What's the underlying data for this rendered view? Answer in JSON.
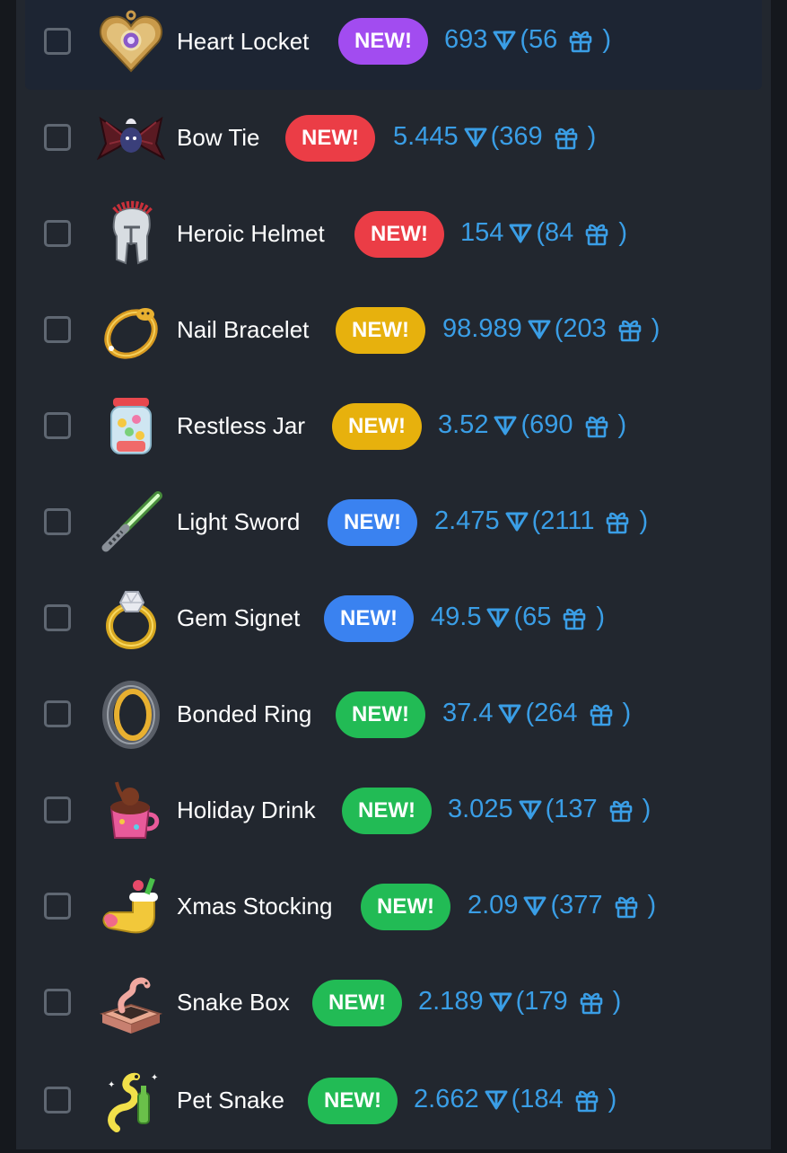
{
  "colors": {
    "background": "#15181d",
    "panel": "#22272f",
    "highlight_row": "#1d2533",
    "name_text": "#ffffff",
    "price_text": "#3a9ee6",
    "checkbox_border": "#5f6772"
  },
  "items": [
    {
      "name": "Heart Locket",
      "badge": "NEW!",
      "badge_color": "#a24cf0",
      "price": "693",
      "supply": "(56",
      "close": ")",
      "selected": false,
      "highlighted": true
    },
    {
      "name": "Bow Tie",
      "badge": "NEW!",
      "badge_color": "#eb3d46",
      "price": "5.445",
      "supply": "(369",
      "close": ")",
      "selected": false,
      "highlighted": false
    },
    {
      "name": "Heroic Helmet",
      "badge": "NEW!",
      "badge_color": "#eb3d46",
      "price": "154",
      "supply": "(84",
      "close": ")",
      "selected": false,
      "highlighted": false
    },
    {
      "name": "Nail Bracelet",
      "badge": "NEW!",
      "badge_color": "#e7b10d",
      "price": "98.989",
      "supply": "(203",
      "close": ")",
      "selected": false,
      "highlighted": false
    },
    {
      "name": "Restless Jar",
      "badge": "NEW!",
      "badge_color": "#e7b10d",
      "price": "3.52",
      "supply": "(690",
      "close": ")",
      "selected": false,
      "highlighted": false
    },
    {
      "name": "Light Sword",
      "badge": "NEW!",
      "badge_color": "#3a82f0",
      "price": "2.475",
      "supply": "(2111",
      "close": ")",
      "selected": false,
      "highlighted": false
    },
    {
      "name": "Gem Signet",
      "badge": "NEW!",
      "badge_color": "#3a82f0",
      "price": "49.5",
      "supply": "(65",
      "close": ")",
      "selected": false,
      "highlighted": false
    },
    {
      "name": "Bonded Ring",
      "badge": "NEW!",
      "badge_color": "#22bb55",
      "price": "37.4",
      "supply": "(264",
      "close": ")",
      "selected": false,
      "highlighted": false
    },
    {
      "name": "Holiday Drink",
      "badge": "NEW!",
      "badge_color": "#22bb55",
      "price": "3.025",
      "supply": "(137",
      "close": ")",
      "selected": false,
      "highlighted": false
    },
    {
      "name": "Xmas Stocking",
      "badge": "NEW!",
      "badge_color": "#22bb55",
      "price": "2.09",
      "supply": "(377",
      "close": ")",
      "selected": false,
      "highlighted": false
    },
    {
      "name": "Snake Box",
      "badge": "NEW!",
      "badge_color": "#22bb55",
      "price": "2.189",
      "supply": "(179",
      "close": ")",
      "selected": false,
      "highlighted": false
    },
    {
      "name": "Pet Snake",
      "badge": "NEW!",
      "badge_color": "#22bb55",
      "price": "2.662",
      "supply": "(184",
      "close": ")",
      "selected": false,
      "highlighted": false
    }
  ],
  "icons": {
    "currency": "ton-icon",
    "supply": "gift-icon"
  }
}
